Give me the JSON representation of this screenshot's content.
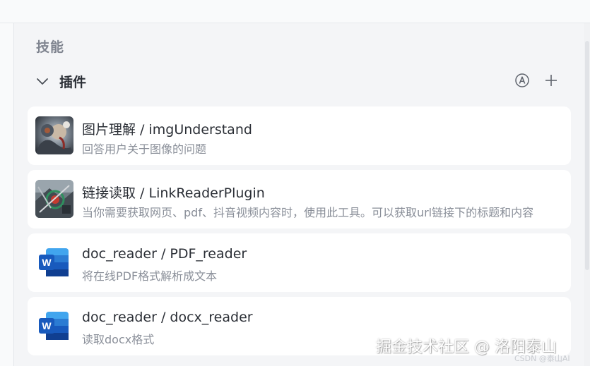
{
  "skills": {
    "section_title": "技能",
    "group": {
      "title": "插件",
      "auto_icon": "circled-a-icon",
      "add_icon": "plus-icon",
      "collapse_icon": "chevron-down-icon"
    },
    "plugins": [
      {
        "title": "图片理解 / imgUnderstand",
        "description": "回答用户关于图像的问题",
        "icon": "robot-image-thumbnail"
      },
      {
        "title": "链接读取 / LinkReaderPlugin",
        "description": "当你需要获取网页、pdf、抖音视频内容时，使用此工具。可以获取url链接下的标题和内容",
        "icon": "link-reader-thumbnail"
      },
      {
        "title": "doc_reader / PDF_reader",
        "description": "将在线PDF格式解析成文本",
        "icon": "word-document-icon"
      },
      {
        "title": "doc_reader / docx_reader",
        "description": "读取docx格式",
        "icon": "word-document-icon"
      }
    ]
  },
  "watermark": {
    "main": "掘金技术社区 @ 洛阳泰山",
    "sub": "CSDN @泰山AI"
  },
  "colors": {
    "word_blue": "#185abd",
    "word_blue_light": "#41a5ee",
    "card_bg": "#ffffff",
    "panel_bg": "#f4f5f7"
  }
}
